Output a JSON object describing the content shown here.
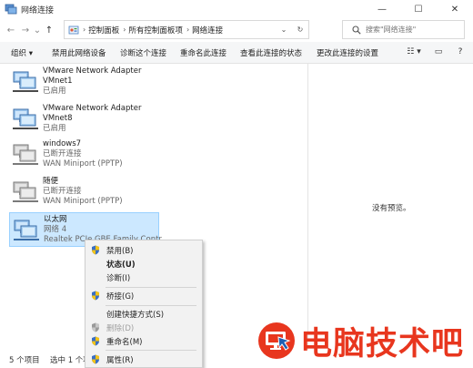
{
  "window": {
    "title": "网络连接",
    "minimize": "—",
    "maximize": "☐",
    "close": "✕"
  },
  "nav": {
    "back": "←",
    "forward": "→",
    "recent": "⌄",
    "up": "↑"
  },
  "address": {
    "crumbs": [
      "控制面板",
      "所有控制面板项",
      "网络连接"
    ],
    "separator": "›",
    "dropdown": "⌄",
    "refresh": "↻"
  },
  "search": {
    "placeholder": "搜索\"网络连接\""
  },
  "toolbar": {
    "organize": "组织 ▾",
    "disable": "禁用此网络设备",
    "diagnose": "诊断这个连接",
    "rename": "重命名此连接",
    "view_status": "查看此连接的状态",
    "change_settings": "更改此连接的设置",
    "view_icon": "☷ ▾",
    "pane_icon": "▭",
    "help_icon": "?"
  },
  "connections": [
    {
      "name": "VMware Network Adapter",
      "line2": "VMnet1",
      "line3": "已启用",
      "icon": "network-adapter-icon"
    },
    {
      "name": "VMware Network Adapter",
      "line2": "VMnet8",
      "line3": "已启用",
      "icon": "network-adapter-icon"
    },
    {
      "name": "windows7",
      "line2": "已断开连接",
      "line3": "WAN Miniport (PPTP)",
      "icon": "network-adapter-disconnected-icon"
    },
    {
      "name": "随便",
      "line2": "已断开连接",
      "line3": "WAN Miniport (PPTP)",
      "icon": "network-adapter-disconnected-icon"
    },
    {
      "name": "以太网",
      "line2": "网络 4",
      "line3": "Realtek PCIe GBE Family Contr...",
      "icon": "ethernet-adapter-icon"
    }
  ],
  "preview": {
    "text": "没有预览。"
  },
  "status": {
    "count": "5 个项目",
    "selected": "选中 1 个项目"
  },
  "context_menu": {
    "disable": "禁用(B)",
    "status": "状态(U)",
    "diagnose": "诊断(I)",
    "bridge": "桥接(G)",
    "shortcut": "创建快捷方式(S)",
    "delete": "删除(D)",
    "rename": "重命名(M)",
    "properties": "属性(R)"
  },
  "watermark": {
    "text": "电脑技术吧"
  },
  "colors": {
    "selection_bg": "#cce8ff",
    "selection_border": "#99d1ff",
    "watermark_red": "#e8361e",
    "toolbar_bg": "#f5f6f7",
    "menu_bg": "#f2f2f2"
  }
}
